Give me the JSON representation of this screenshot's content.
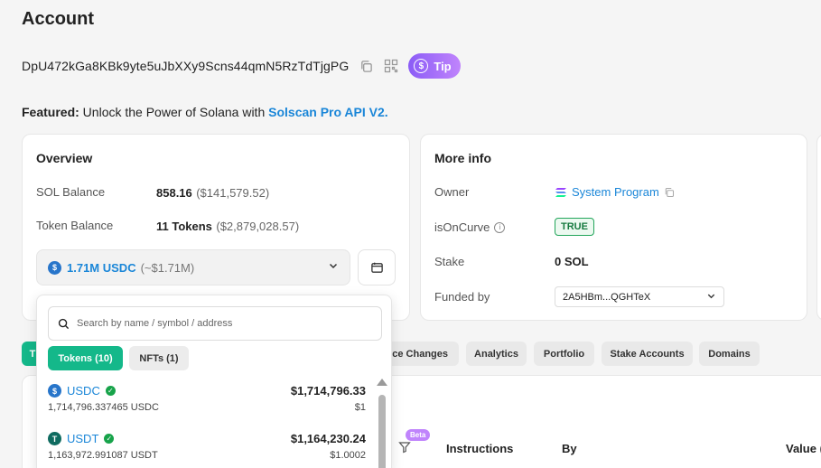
{
  "page": {
    "title": "Account"
  },
  "account": {
    "address": "DpU472kGa8KBk9yte5uJbXXy9Scns44qmN5RzTdTjgPG",
    "tip_label": "Tip"
  },
  "featured": {
    "prefix": "Featured:",
    "text": " Unlock the Power of Solana with ",
    "link": "Solscan Pro API V2."
  },
  "overview": {
    "title": "Overview",
    "sol_label": "SOL Balance",
    "sol_value": "858.16",
    "sol_usd": "($141,579.52)",
    "token_label": "Token Balance",
    "token_value": "11 Tokens",
    "token_usd": "($2,879,028.57)",
    "selected_token": "1.71M USDC",
    "selected_token_usd": "(~$1.71M)"
  },
  "more_info": {
    "title": "More info",
    "owner_label": "Owner",
    "owner_value": "System Program",
    "oncurve_label": "isOnCurve",
    "oncurve_value": "TRUE",
    "stake_label": "Stake",
    "stake_value": "0 SOL",
    "funded_label": "Funded by",
    "funded_value": "2A5HBm...QGHTeX"
  },
  "dropdown": {
    "search_placeholder": "Search by name / symbol / address",
    "tab_tokens": "Tokens (10)",
    "tab_nfts": "NFTs (1)",
    "tokens": [
      {
        "symbol": "USDC",
        "amount": "1,714,796.337465 USDC",
        "value": "$1,714,796.33",
        "price": "$1",
        "icon": "usdc-icon"
      },
      {
        "symbol": "USDT",
        "amount": "1,163,972.991087 USDT",
        "value": "$1,164,230.24",
        "price": "$1.0002",
        "icon": "usdt-icon"
      }
    ]
  },
  "tabs": {
    "balance_changes": "nce Changes",
    "analytics": "Analytics",
    "portfolio": "Portfolio",
    "stake_accounts": "Stake Accounts",
    "domains": "Domains"
  },
  "table": {
    "beta": "Beta",
    "instructions": "Instructions",
    "by": "By",
    "value": "Value ("
  },
  "colors": {
    "accent": "#14b88a",
    "link": "#1a86d8",
    "tip_gradient": "#8b5cf6"
  }
}
